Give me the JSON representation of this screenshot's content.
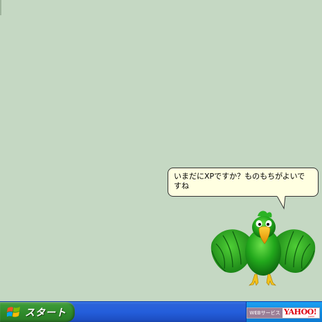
{
  "balloon": {
    "message": "いまだにXPですか？ものもちがよいですね"
  },
  "taskbar": {
    "start_label": "スタート",
    "start_icon": "windows-logo-icon",
    "tray": {
      "web_services_label": "WEBサービス",
      "yahoo_logo_text": "YAHOO!",
      "yahoo_region_text": "JAPAN"
    }
  },
  "assistant": {
    "icon": "parrot-assistant-icon"
  },
  "colors": {
    "desktop_background": "#c5d8c3",
    "taskbar_blue": "#245edb",
    "start_green": "#2f8a2b",
    "balloon_fill": "#ffffe1",
    "yahoo_red": "#e00010"
  }
}
